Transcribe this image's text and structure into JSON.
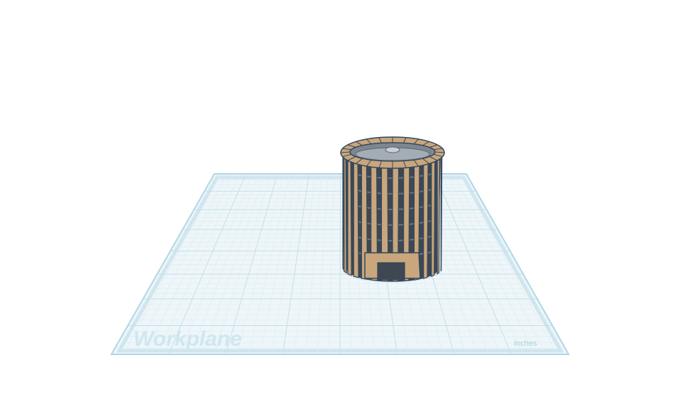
{
  "workplane": {
    "label": "Workplane",
    "units": "Inches"
  },
  "colors": {
    "background": "#ffffff",
    "plane_fill": "#eef6f9",
    "plane_border": "#a6d3e3",
    "grid_minor": "#dcebf1",
    "grid_major": "#c4dfe9",
    "object_wood": "#c9a67c",
    "object_outline": "#33485e",
    "object_dark": "#3e4752"
  },
  "scene_object": {
    "name": "slatted-cylinder",
    "icon": "cylindrical-slat-basket"
  }
}
